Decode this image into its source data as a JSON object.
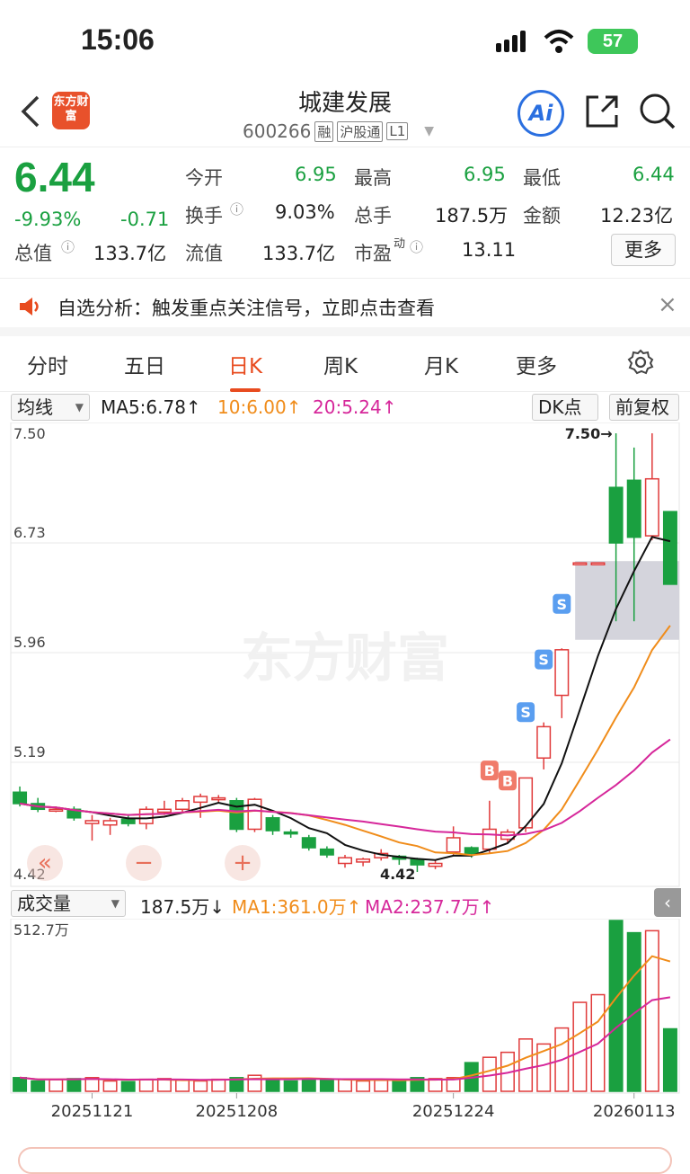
{
  "status": {
    "time": "15:06",
    "battery": "57"
  },
  "nav": {
    "title": "城建发展",
    "code": "600266",
    "tag_rong": "融",
    "tag_hgt": "沪股通",
    "tag_level": "L1",
    "logo": "东方财富",
    "ai_label": "Ai"
  },
  "quote": {
    "price": "6.44",
    "change_pct": "-9.93%",
    "change": "-0.71",
    "open_label": "今开",
    "open": "6.95",
    "high_label": "最高",
    "high": "6.95",
    "low_label": "最低",
    "low": "6.44",
    "turnover_label": "换手",
    "turnover": "9.03%",
    "volume_label": "总手",
    "volume": "187.5万",
    "amount_label": "金额",
    "amount": "12.23亿",
    "mktcap_label": "总值",
    "mktcap": "133.7亿",
    "float_label": "流值",
    "float": "133.7亿",
    "pe_label": "市盈",
    "pe_sup": "动",
    "pe": "13.11",
    "more_label": "更多"
  },
  "notice": {
    "text": "自选分析：触发重点关注信号，立即点击查看"
  },
  "tabs": [
    "分时",
    "五日",
    "日K",
    "周K",
    "月K",
    "更多"
  ],
  "indicator": {
    "select": "均线",
    "ma5": "MA5:6.78↑",
    "ma10": "10:6.00↑",
    "ma20": "20:5.24↑",
    "dk": "DK点",
    "adj": "前复权"
  },
  "kline": {
    "y_labels": [
      "7.50",
      "6.73",
      "5.96",
      "5.19",
      "4.42"
    ],
    "max_label": "7.50→",
    "min_label": "4.42",
    "watermark": "东方财富",
    "signal_b": "B",
    "signal_s": "S"
  },
  "volume": {
    "select": "成交量",
    "current": "187.5万↓",
    "ma1": "MA1:361.0万↑",
    "ma2": "MA2:237.7万↑",
    "max_label": "512.7万"
  },
  "dates": [
    "20251121",
    "20251208",
    "20251224",
    "20260113"
  ],
  "colors": {
    "up": "#e03a3a",
    "down": "#1aa040",
    "accent": "#e84b1f",
    "ma5": "#111111",
    "ma10": "#f08c1a",
    "ma20": "#d6279a"
  },
  "chart_data": {
    "type": "candlestick",
    "ylim": [
      4.42,
      7.5
    ],
    "candles": [
      {
        "o": 4.98,
        "c": 4.9,
        "h": 5.02,
        "l": 4.88
      },
      {
        "o": 4.9,
        "c": 4.86,
        "h": 4.94,
        "l": 4.84
      },
      {
        "o": 4.86,
        "c": 4.86,
        "h": 4.88,
        "l": 4.84
      },
      {
        "o": 4.86,
        "c": 4.8,
        "h": 4.88,
        "l": 4.78
      },
      {
        "o": 4.76,
        "c": 4.78,
        "h": 4.82,
        "l": 4.64
      },
      {
        "o": 4.75,
        "c": 4.78,
        "h": 4.8,
        "l": 4.68
      },
      {
        "o": 4.79,
        "c": 4.76,
        "h": 4.82,
        "l": 4.74
      },
      {
        "o": 4.76,
        "c": 4.86,
        "h": 4.88,
        "l": 4.72
      },
      {
        "o": 4.84,
        "c": 4.86,
        "h": 4.92,
        "l": 4.82
      },
      {
        "o": 4.86,
        "c": 4.92,
        "h": 4.94,
        "l": 4.84
      },
      {
        "o": 4.91,
        "c": 4.95,
        "h": 4.97,
        "l": 4.8
      },
      {
        "o": 4.94,
        "c": 4.94,
        "h": 4.96,
        "l": 4.9
      },
      {
        "o": 4.92,
        "c": 4.72,
        "h": 4.94,
        "l": 4.7
      },
      {
        "o": 4.72,
        "c": 4.93,
        "h": 4.94,
        "l": 4.7
      },
      {
        "o": 4.8,
        "c": 4.71,
        "h": 4.82,
        "l": 4.68
      },
      {
        "o": 4.7,
        "c": 4.69,
        "h": 4.72,
        "l": 4.66
      },
      {
        "o": 4.66,
        "c": 4.59,
        "h": 4.68,
        "l": 4.57
      },
      {
        "o": 4.58,
        "c": 4.54,
        "h": 4.6,
        "l": 4.52
      },
      {
        "o": 4.48,
        "c": 4.52,
        "h": 4.54,
        "l": 4.45
      },
      {
        "o": 4.49,
        "c": 4.51,
        "h": 4.52,
        "l": 4.46
      },
      {
        "o": 4.52,
        "c": 4.55,
        "h": 4.58,
        "l": 4.5
      },
      {
        "o": 4.53,
        "c": 4.51,
        "h": 4.54,
        "l": 4.47
      },
      {
        "o": 4.51,
        "c": 4.47,
        "h": 4.52,
        "l": 4.42
      },
      {
        "o": 4.46,
        "c": 4.48,
        "h": 4.5,
        "l": 4.44
      },
      {
        "o": 4.56,
        "c": 4.66,
        "h": 4.74,
        "l": 4.54
      },
      {
        "o": 4.59,
        "c": 4.55,
        "h": 4.6,
        "l": 4.52
      },
      {
        "o": 4.58,
        "c": 4.72,
        "h": 4.92,
        "l": 4.55
      },
      {
        "o": 4.65,
        "c": 4.7,
        "h": 4.72,
        "l": 4.62
      },
      {
        "o": 4.73,
        "c": 5.08,
        "h": 5.08,
        "l": 4.7
      },
      {
        "o": 5.22,
        "c": 5.44,
        "h": 5.47,
        "l": 5.14
      },
      {
        "o": 5.66,
        "c": 5.98,
        "h": 5.99,
        "l": 5.5
      },
      {
        "o": 6.59,
        "c": 6.59,
        "h": 6.59,
        "l": 6.59
      },
      {
        "o": 6.59,
        "c": 6.59,
        "h": 6.59,
        "l": 6.59
      },
      {
        "o": 7.12,
        "c": 6.73,
        "h": 7.5,
        "l": 6.18
      },
      {
        "o": 7.17,
        "c": 6.77,
        "h": 7.4,
        "l": 6.18
      },
      {
        "o": 6.78,
        "c": 7.18,
        "h": 7.5,
        "l": 6.75
      },
      {
        "o": 6.95,
        "c": 6.44,
        "h": 6.95,
        "l": 6.44
      }
    ],
    "volume": [
      41,
      31,
      35,
      38,
      41,
      31,
      29,
      36,
      38,
      33,
      31,
      36,
      41,
      48,
      38,
      31,
      38,
      33,
      36,
      31,
      33,
      31,
      41,
      38,
      41,
      86,
      102,
      117,
      157,
      142,
      190,
      267,
      290,
      512.7,
      476,
      482,
      187.5
    ]
  }
}
